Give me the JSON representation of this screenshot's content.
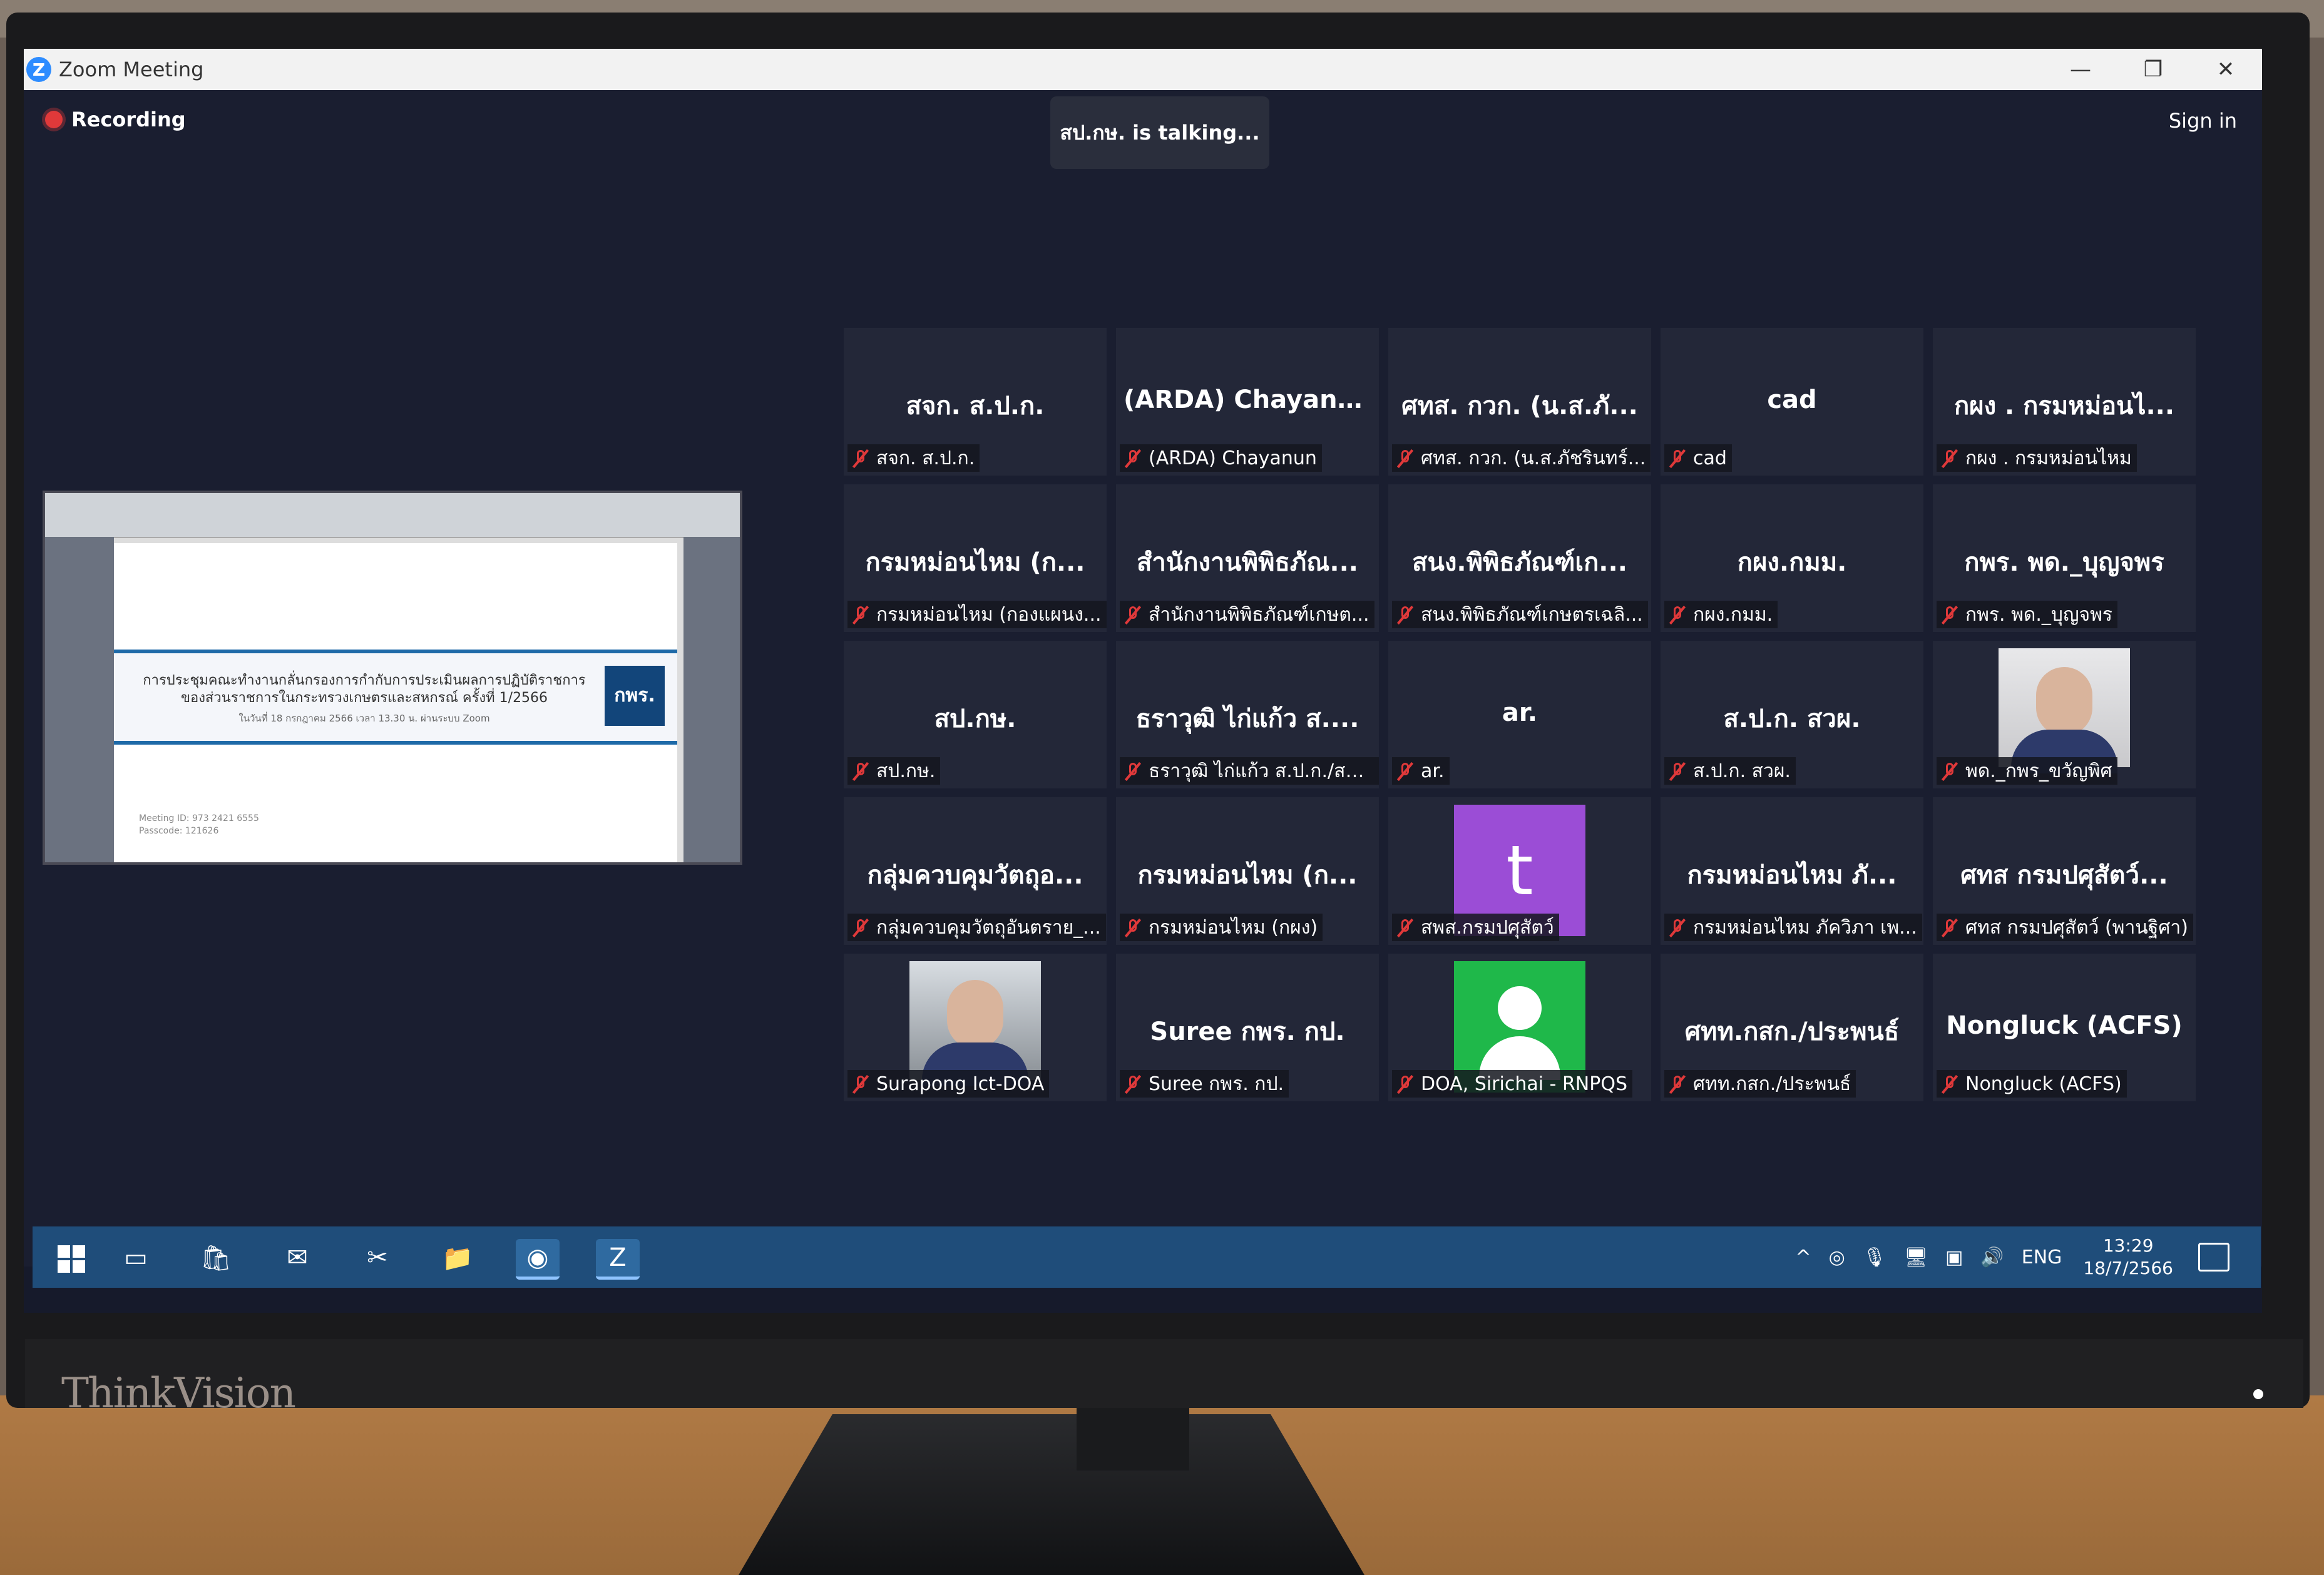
{
  "window": {
    "title": "Zoom Meeting",
    "controls": {
      "minimize": "—",
      "restore": "❐",
      "close": "✕"
    }
  },
  "meeting": {
    "recording_label": "Recording",
    "talking_label": "สป.กษ. is talking...",
    "signin_label": "Sign in"
  },
  "shared_screen": {
    "title": "การประชุมคณะทำงานกลั่นกรองการกำกับการประเมินผลการปฏิบัติราชการ ของส่วนราชการในกระทรวงเกษตรและสหกรณ์ ครั้งที่ 1/2566",
    "subtitle": "ในวันที่ 18 กรกฎาคม 2566 เวลา 13.30 น. ผ่านระบบ Zoom",
    "logo_text": "กพร.",
    "meeting_id": "Meeting ID: 973 2421 6555",
    "passcode": "Passcode: 121626"
  },
  "participants": [
    {
      "display": "สจก. ส.ป.ก.",
      "name": "สจก. ส.ป.ก."
    },
    {
      "display": "(ARDA) Chayanun",
      "name": "(ARDA) Chayanun"
    },
    {
      "display": "ศทส. กวก. (น.ส.ภั...",
      "name": "ศทส. กวก. (น.ส.ภัชรินทร์..."
    },
    {
      "display": "cad",
      "name": "cad"
    },
    {
      "display": "กผง . กรมหม่อนไ...",
      "name": "กผง . กรมหม่อนไหม"
    },
    {
      "display": "กรมหม่อนไหม (ก...",
      "name": "กรมหม่อนไหม (กองแผนง..."
    },
    {
      "display": "สำนักงานพิพิธภัณ...",
      "name": "สำนักงานพิพิธภัณฑ์เกษต..."
    },
    {
      "display": "สนง.พิพิธภัณฑ์เก...",
      "name": "สนง.พิพิธภัณฑ์เกษตรเฉลิ..."
    },
    {
      "display": "กผง.กมม.",
      "name": "กผง.กมม."
    },
    {
      "display": "กพร. พด._บุญจพร",
      "name": "กพร. พด._บุญจพร"
    },
    {
      "display": "สป.กษ.",
      "name": "สป.กษ."
    },
    {
      "display": "ธราวุฒิ ไก่แก้ว ส....",
      "name": "ธราวุฒิ ไก่แก้ว ส.ป.ก./สพ..."
    },
    {
      "display": "ar.",
      "name": "ar."
    },
    {
      "display": "ส.ป.ก. สวผ.",
      "name": "ส.ป.ก. สวผ."
    },
    {
      "display": "",
      "name": "พด._กพร_ขวัญพิศ",
      "video": "cam"
    },
    {
      "display": "กลุ่มควบคุมวัตถุอ...",
      "name": "กลุ่มควบคุมวัตถุอันตราย_..."
    },
    {
      "display": "กรมหม่อนไหม (ก...",
      "name": "กรมหม่อนไหม (กผง)"
    },
    {
      "display": "",
      "name": "สพส.กรมปศุสัตว์",
      "avatar_letter": "t"
    },
    {
      "display": "กรมหม่อนไหม ภั...",
      "name": "กรมหม่อนไหม ภัควิภา เพ..."
    },
    {
      "display": "ศทส กรมปศุสัตว์...",
      "name": "ศทส กรมปศุสัตว์ (พานฐิศา)"
    },
    {
      "display": "",
      "name": "Surapong Ict-DOA",
      "video": "cam2"
    },
    {
      "display": "Suree กพร. กป.",
      "name": "Suree กพร. กป."
    },
    {
      "display": "",
      "name": "DOA, Sirichai - RNPQS",
      "avatar_person": true
    },
    {
      "display": "ศทท.กสก./ประพนธ์",
      "name": "ศทท.กสก./ประพนธ์"
    },
    {
      "display": "Nongluck (ACFS)",
      "name": "Nongluck (ACFS)"
    }
  ],
  "taskbar": {
    "tray": {
      "language": "ENG",
      "time": "13:29",
      "date": "18/7/2566"
    }
  },
  "monitor": {
    "brand": "ThinkVision"
  },
  "colors": {
    "zoom_blue": "#2d8cff",
    "mute_red": "#e0393a",
    "tile_bg": "#232738",
    "taskbar": "#1f4d7a"
  }
}
